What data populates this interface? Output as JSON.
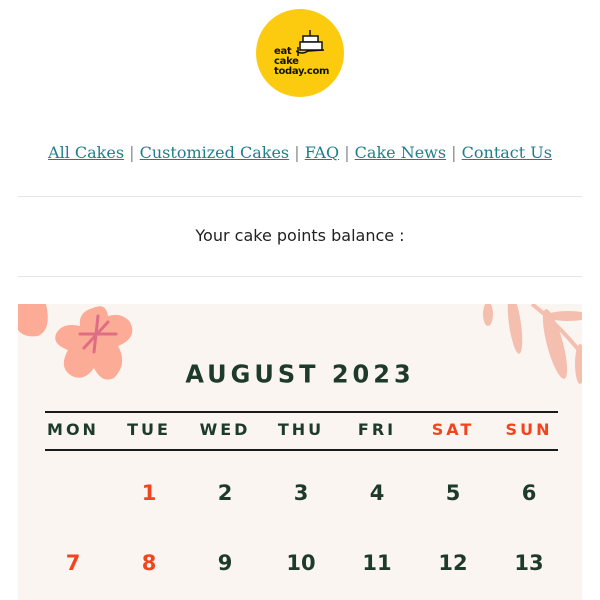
{
  "logo": {
    "lines": [
      "eat",
      "cake",
      "today.com"
    ],
    "alt": "eatcaketoday.com logo",
    "color": "#fccb10"
  },
  "nav": {
    "links": [
      "All Cakes",
      "Customized Cakes",
      "FAQ",
      "Cake News",
      "Contact Us"
    ],
    "separator": "|"
  },
  "balance": {
    "label": "Your cake points balance :"
  },
  "calendar": {
    "title": "AUGUST 2023",
    "weekdays": [
      "MON",
      "TUE",
      "WED",
      "THU",
      "FRI",
      "SAT",
      "SUN"
    ],
    "weekend_color": "#f2451f",
    "text_color": "#1e3a2b",
    "weeks": [
      [
        "",
        "1",
        "2",
        "3",
        "4",
        "5",
        "6"
      ],
      [
        "7",
        "8",
        "9",
        "10",
        "11",
        "12",
        "13"
      ]
    ],
    "highlighted_days": [
      "1",
      "7",
      "8"
    ]
  }
}
